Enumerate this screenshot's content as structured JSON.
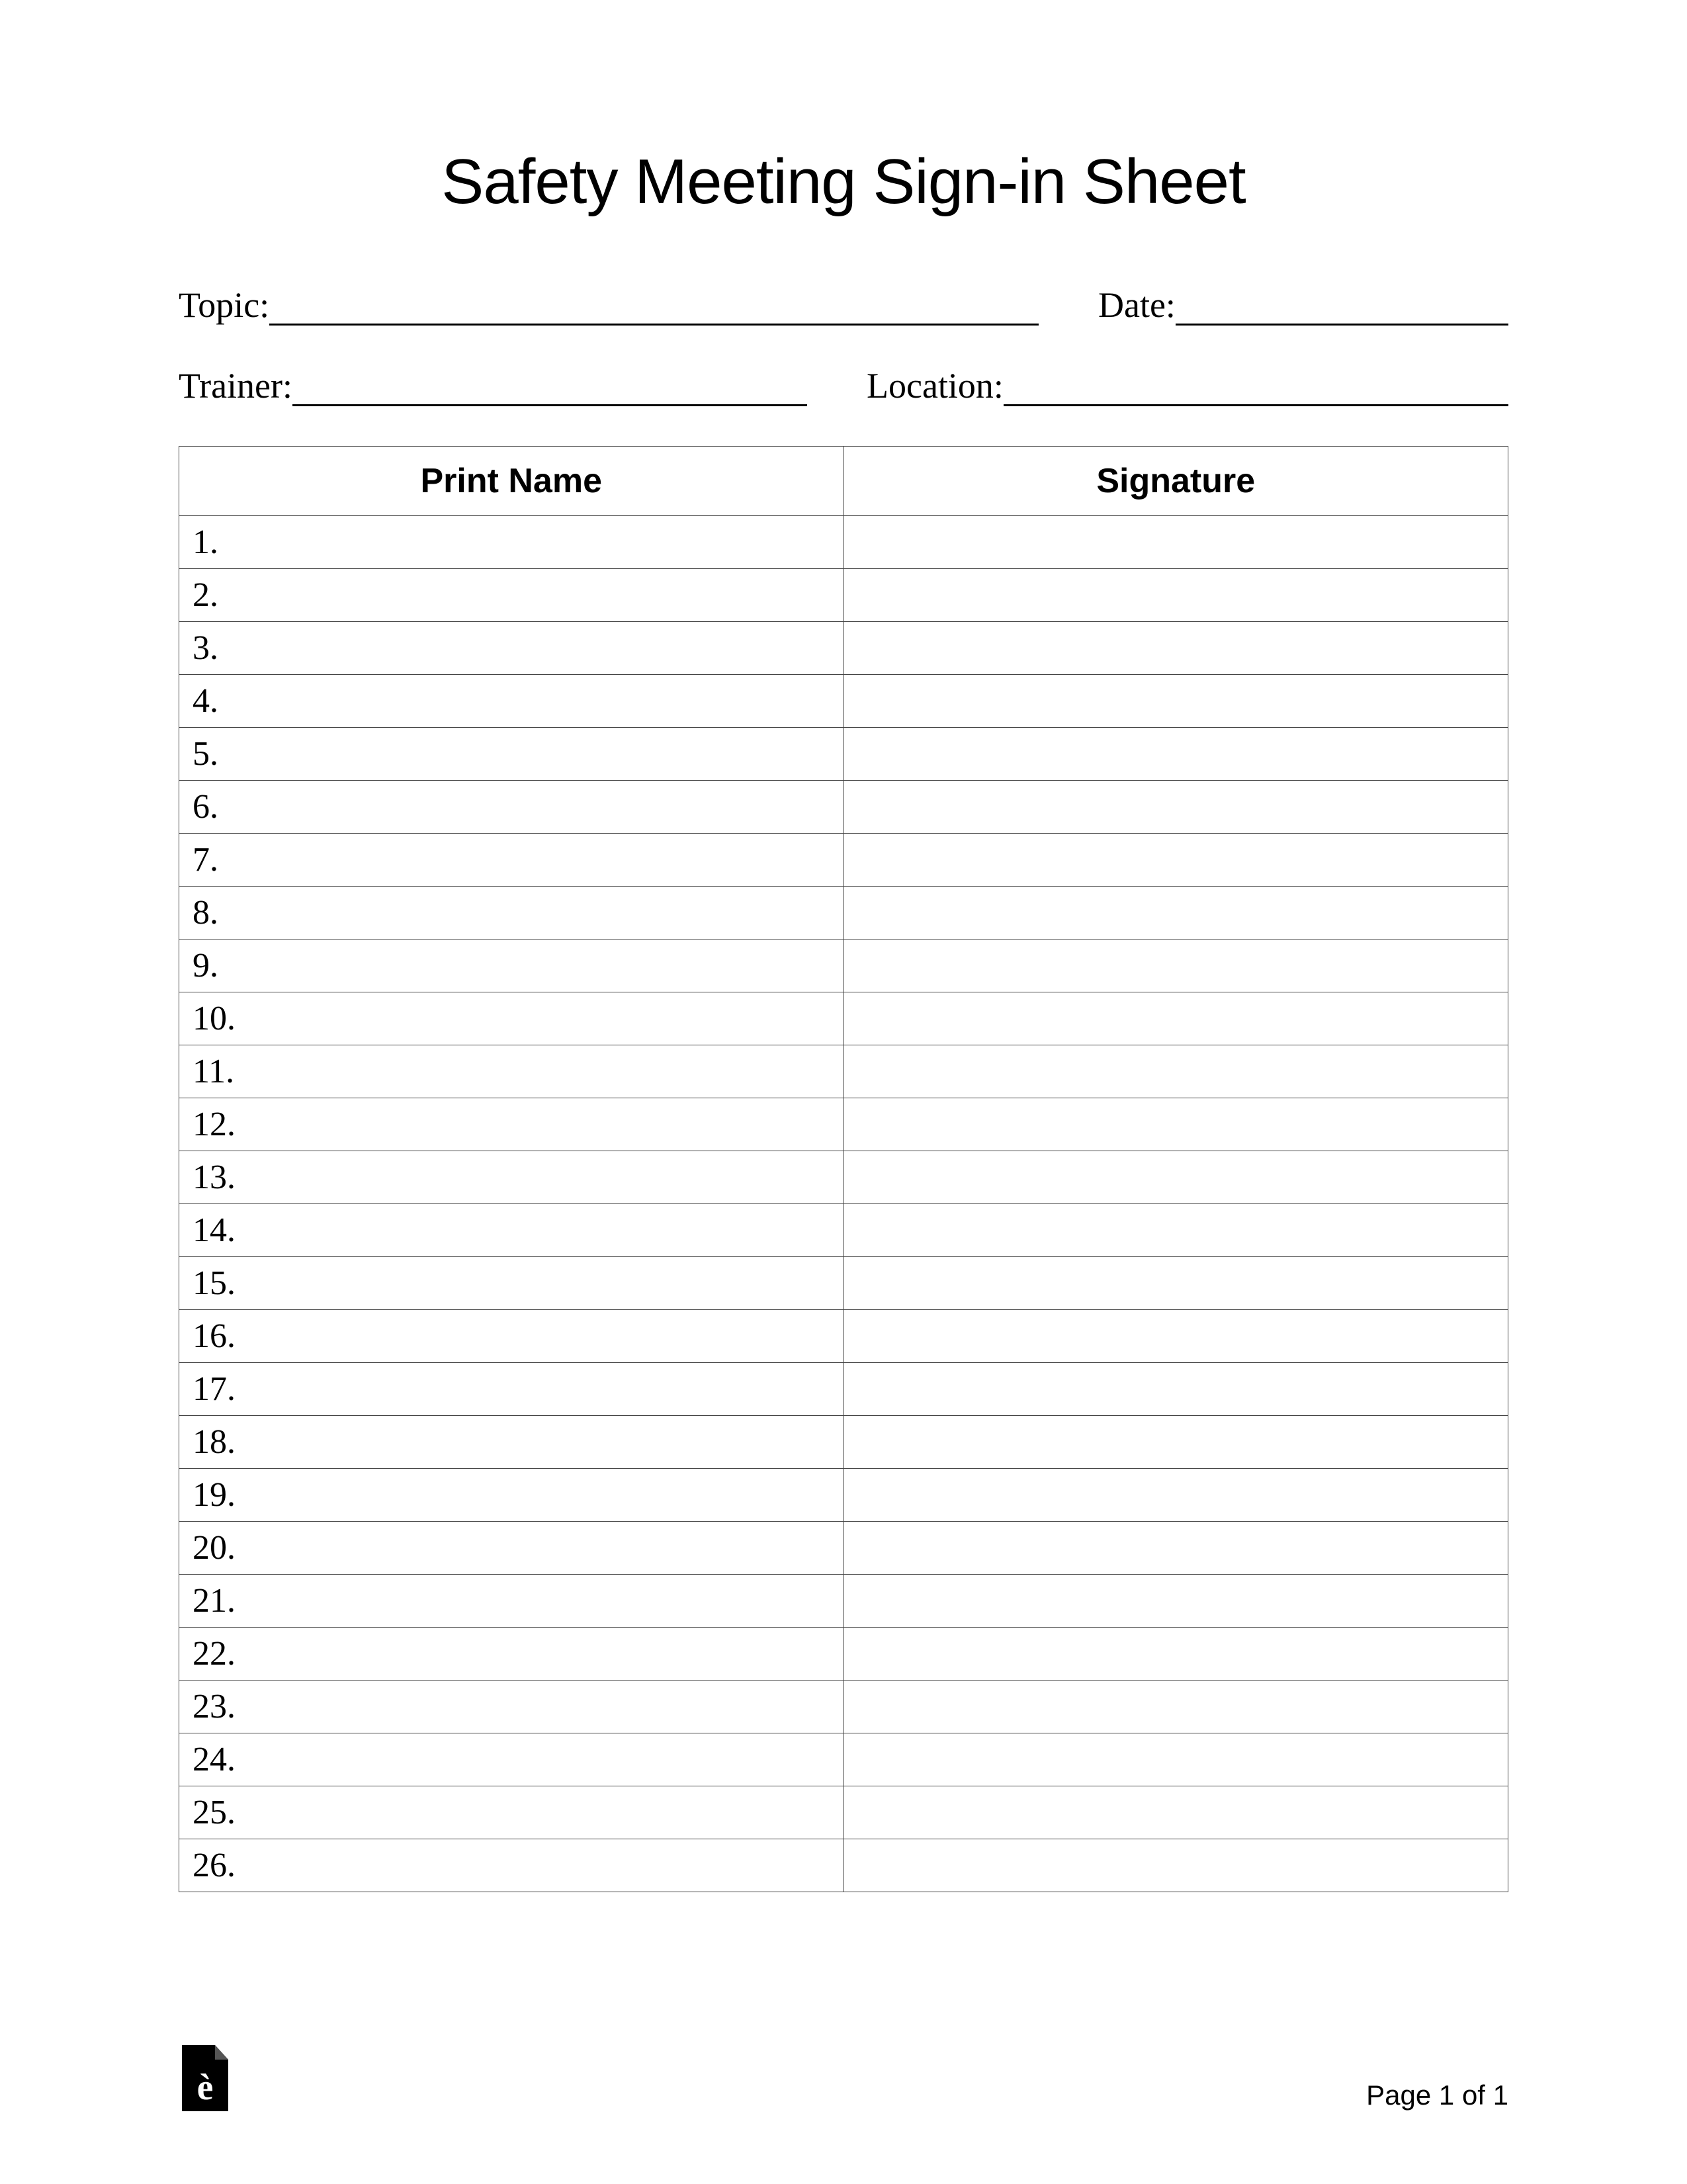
{
  "title": "Safety Meeting Sign-in Sheet",
  "fields": {
    "topic_label": "Topic:",
    "date_label": "Date:",
    "trainer_label": "Trainer:",
    "location_label": "Location:",
    "topic_value": "",
    "date_value": "",
    "trainer_value": "",
    "location_value": ""
  },
  "table": {
    "col_name": "Print Name",
    "col_sig": "Signature",
    "rows": [
      {
        "n": "1."
      },
      {
        "n": "2."
      },
      {
        "n": "3."
      },
      {
        "n": "4."
      },
      {
        "n": "5."
      },
      {
        "n": "6."
      },
      {
        "n": "7."
      },
      {
        "n": "8."
      },
      {
        "n": "9."
      },
      {
        "n": "10."
      },
      {
        "n": "11."
      },
      {
        "n": "12."
      },
      {
        "n": "13."
      },
      {
        "n": "14."
      },
      {
        "n": "15."
      },
      {
        "n": "16."
      },
      {
        "n": "17."
      },
      {
        "n": "18."
      },
      {
        "n": "19."
      },
      {
        "n": "20."
      },
      {
        "n": "21."
      },
      {
        "n": "22."
      },
      {
        "n": "23."
      },
      {
        "n": "24."
      },
      {
        "n": "25."
      },
      {
        "n": "26."
      }
    ]
  },
  "footer": {
    "page": "Page 1 of 1"
  }
}
